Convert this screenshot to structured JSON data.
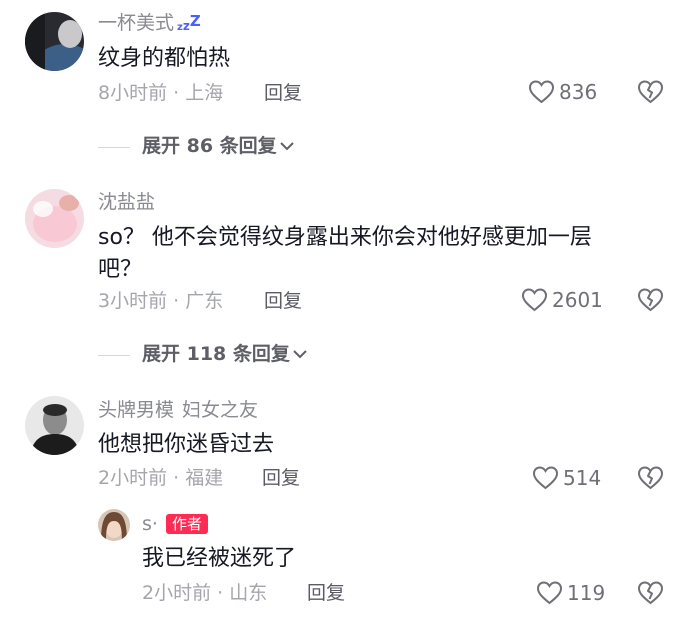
{
  "comments": [
    {
      "username": "一杯美式",
      "text": "纹身的都怕热",
      "time": "8小时前",
      "location": "上海",
      "reply_label": "回复",
      "likes": "836"
    },
    {
      "username": "沈盐盐",
      "text_line1": "so？ 他不会觉得纹身露出来你会对他好感更加一层",
      "text_line2": "吧？",
      "time": "3小时前",
      "location": "广东",
      "reply_label": "回复",
      "likes": "2601"
    },
    {
      "username": "头牌男模",
      "username_tag": "妇女之友",
      "text": "他想把你迷昏过去",
      "time": "2小时前",
      "location": "福建",
      "reply_label": "回复",
      "likes": "514"
    }
  ],
  "nested_reply": {
    "username": "s·",
    "badge": "作者",
    "text": "我已经被迷死了",
    "time": "2小时前",
    "location": "山东",
    "reply_label": "回复",
    "likes": "119"
  },
  "expand_links": [
    {
      "label": "展开 86 条回复"
    },
    {
      "label": "展开 118 条回复"
    }
  ],
  "colors": {
    "badge_bg": "#fe2c55",
    "meta_gray": "#a5a6ab",
    "name_gray": "#8a8b91",
    "text_dark": "#161823"
  }
}
